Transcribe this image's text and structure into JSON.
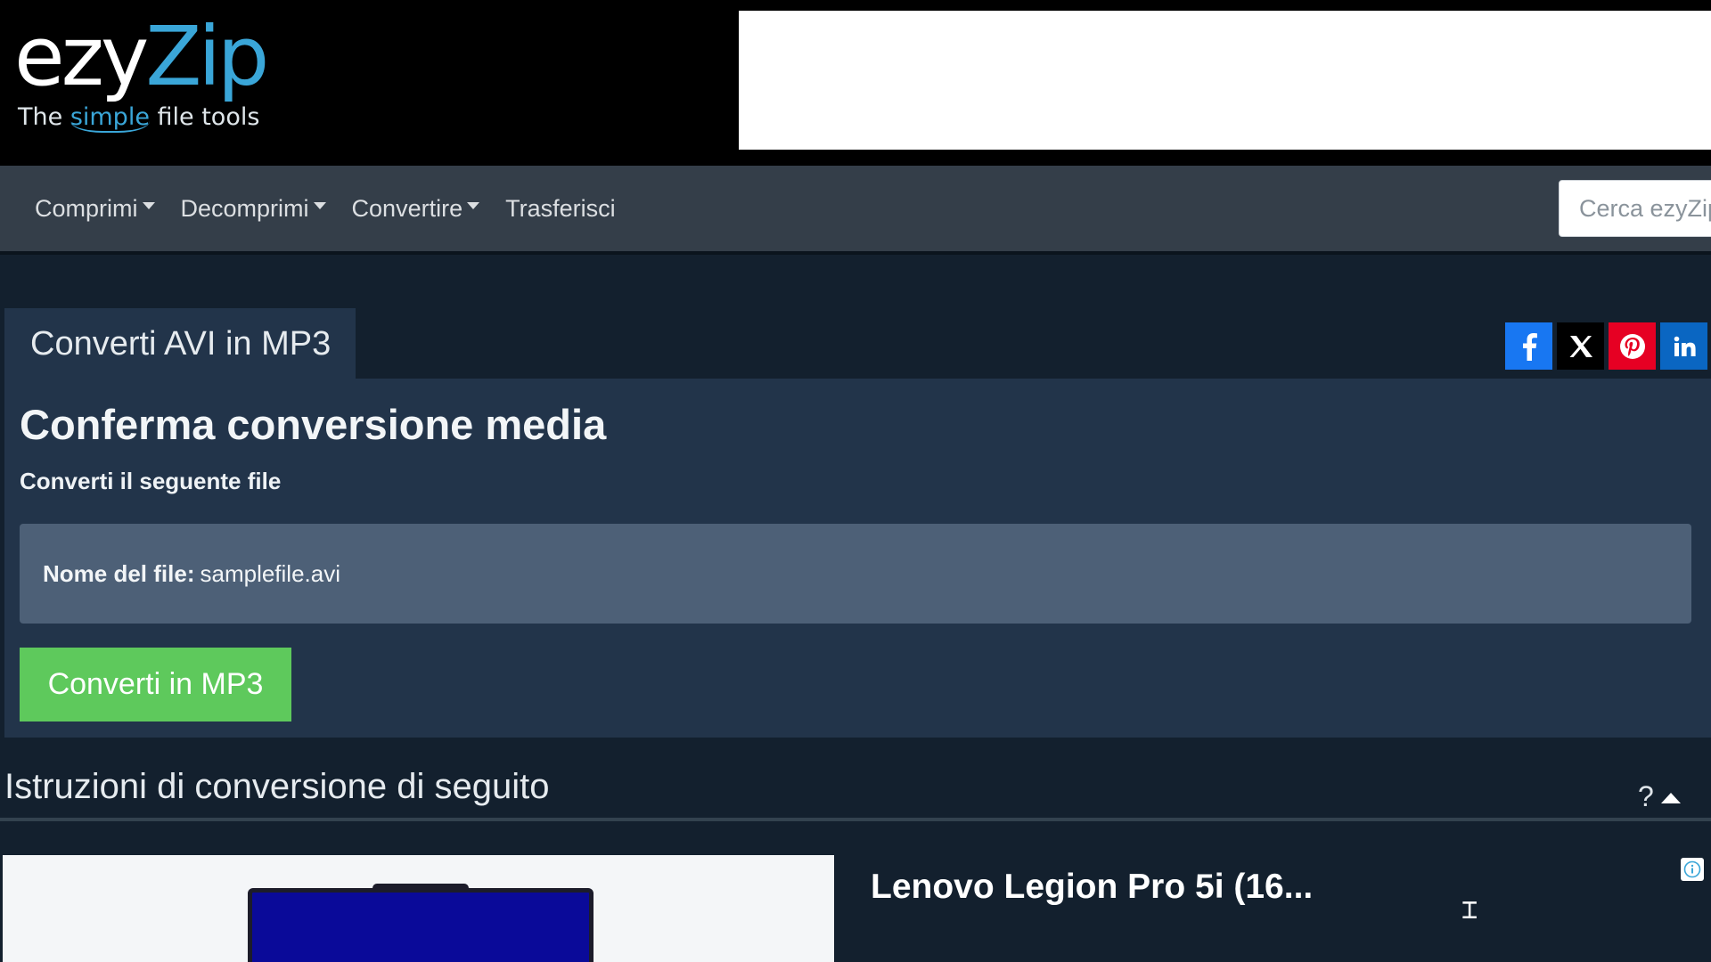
{
  "header": {
    "logo_ezy": "ezy",
    "logo_zip": "Zip",
    "tagline_pre": "The ",
    "tagline_simple": "simple",
    "tagline_post": " file tools"
  },
  "nav": {
    "items": [
      {
        "label": "Comprimi",
        "dropdown": true
      },
      {
        "label": "Decomprimi",
        "dropdown": true
      },
      {
        "label": "Convertire",
        "dropdown": true
      },
      {
        "label": "Trasferisci",
        "dropdown": false
      }
    ],
    "search_placeholder": "Cerca ezyZip"
  },
  "tab": {
    "label": "Converti AVI in MP3"
  },
  "social": {
    "icons": [
      "facebook-icon",
      "x-icon",
      "pinterest-icon",
      "linkedin-icon"
    ],
    "colors": {
      "facebook": "#1877f2",
      "x": "#000000",
      "pinterest": "#e60023",
      "linkedin": "#0a66c2"
    }
  },
  "card": {
    "title": "Conferma conversione media",
    "subtitle": "Converti il seguente file",
    "file_label": "Nome del file:",
    "file_name": "samplefile.avi",
    "convert_button": "Converti in MP3"
  },
  "instructions": {
    "title": "Istruzioni di conversione di seguito",
    "help": "?"
  },
  "ad": {
    "title": "Lenovo Legion Pro 5i (16..."
  },
  "colors": {
    "page_bg": "#13202e",
    "card_bg": "#22344a",
    "file_box_bg": "#4d6077",
    "navbar_bg": "#343e49",
    "accent_green": "#5ec95c",
    "brand_blue": "#3aa6d8"
  }
}
